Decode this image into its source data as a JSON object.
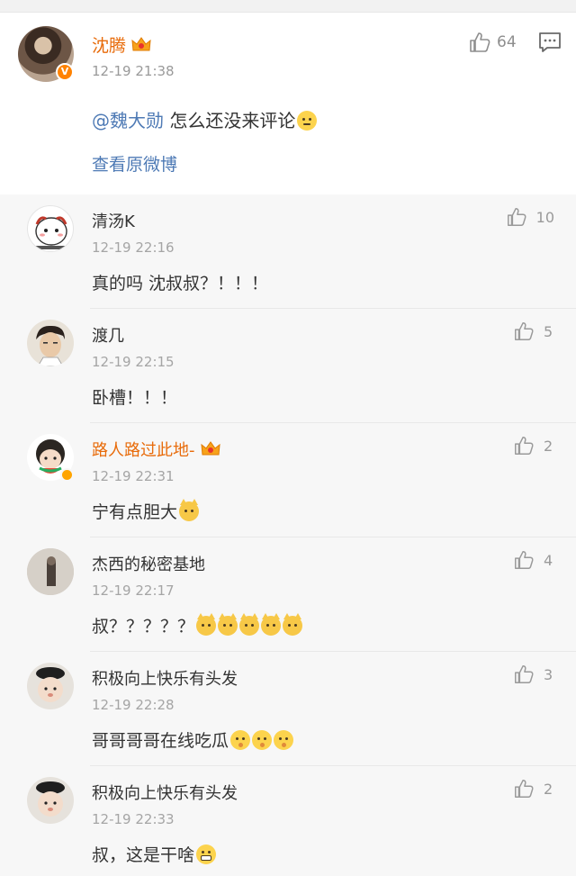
{
  "post": {
    "author": "沈腾",
    "time": "12-19 21:38",
    "likes": "64",
    "mention": "@魏大勋",
    "text": " 怎么还没来评论",
    "view_original": "查看原微博"
  },
  "comments": [
    {
      "name": "清汤K",
      "time": "12-19 22:16",
      "text": "真的吗 沈叔叔？！！！",
      "likes": "10",
      "vip": false
    },
    {
      "name": "渡几",
      "time": "12-19 22:15",
      "text": "卧槽！！！",
      "likes": "5",
      "vip": false
    },
    {
      "name": "路人路过此地-",
      "time": "12-19 22:31",
      "text": "宁有点胆大",
      "likes": "2",
      "vip": true
    },
    {
      "name": "杰西的秘密基地",
      "time": "12-19 22:17",
      "text": "叔？？？？？",
      "likes": "4",
      "vip": false
    },
    {
      "name": "积极向上快乐有头发",
      "time": "12-19 22:28",
      "text": "哥哥哥哥在线吃瓜",
      "likes": "3",
      "vip": false
    },
    {
      "name": "积极向上快乐有头发",
      "time": "12-19 22:33",
      "text": "叔，这是干啥",
      "likes": "2",
      "vip": false
    }
  ],
  "icons": {
    "thumb": "thumbs-up-icon",
    "comment": "comment-icon",
    "verified": "verified-badge-icon",
    "crown": "vip-crown-icon"
  },
  "colors": {
    "vip_name": "#e86b0a",
    "link": "#4e7ab5",
    "timestamp": "#9a9a9a"
  }
}
